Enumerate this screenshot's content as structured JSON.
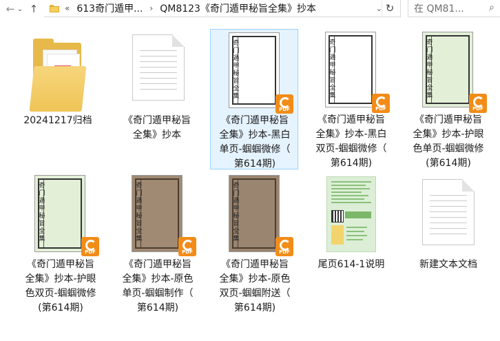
{
  "address_bar": {
    "crumbs": [
      "613奇门遁甲...",
      "QM8123《奇门遁甲秘旨全集》抄本"
    ],
    "overflow_glyph": "«",
    "separator": "›"
  },
  "search": {
    "placeholder": "在 QM81..."
  },
  "files": [
    {
      "name": "20241217归档",
      "kind": "folder"
    },
    {
      "name": "《奇门遁甲秘旨\n全集》抄本",
      "kind": "text-document"
    },
    {
      "name": "《奇门遁甲秘旨\n全集》抄本-黑白\n单页-蝈蝈微修（\n第614期)",
      "kind": "pdf",
      "page_color": "#ffffff",
      "selected": true
    },
    {
      "name": "《奇门遁甲秘旨\n全集》抄本-黑白\n双页-蝈蝈微修（\n第614期)",
      "kind": "pdf",
      "page_color": "#ffffff"
    },
    {
      "name": "《奇门遁甲秘旨\n全集》抄本-护眼\n色单页-蝈蝈微修\n(第614期)",
      "kind": "pdf",
      "page_color": "#e3efd7"
    },
    {
      "name": "《奇门遁甲秘旨\n全集》抄本-护眼\n色双页-蝈蝈微修\n(第614期)",
      "kind": "pdf",
      "page_color": "#e3efd7"
    },
    {
      "name": "《奇门遁甲秘旨\n全集》抄本-原色\n单页-蝈蝈制作（\n第614期)",
      "kind": "pdf",
      "page_color": "#a08a74"
    },
    {
      "name": "《奇门遁甲秘旨\n全集》抄本-原色\n双页-蝈蝈附送（\n第614期)",
      "kind": "pdf",
      "page_color": "#9a8570"
    },
    {
      "name": "尾页614-1说明",
      "kind": "image"
    },
    {
      "name": "新建文本文档",
      "kind": "text-document"
    }
  ],
  "pdf_badge_label": "PDF",
  "cover_title": "奇门遁甲秘旨全集"
}
